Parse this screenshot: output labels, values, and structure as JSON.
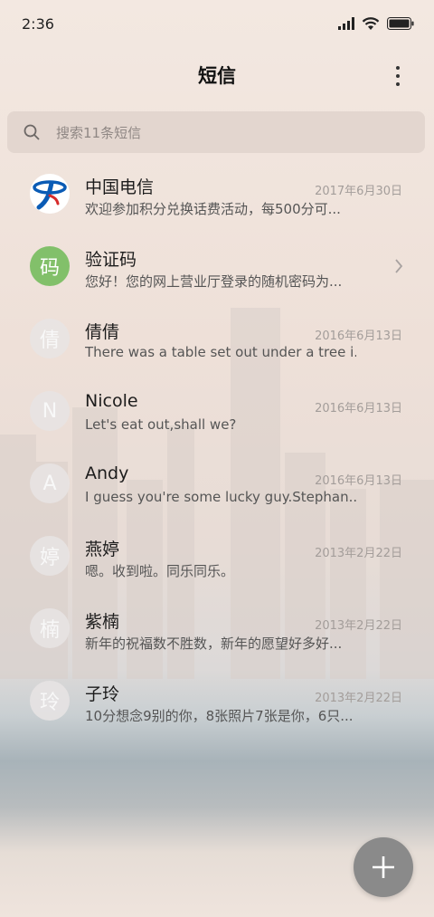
{
  "status_bar": {
    "time": "2:36"
  },
  "header": {
    "title": "短信"
  },
  "search": {
    "placeholder": "搜索11条短信"
  },
  "conversations": [
    {
      "name": "中国电信",
      "date": "2017年6月30日",
      "snippet": "欢迎参加积分兑换话费活动，每500分可...",
      "avatar_type": "logo",
      "avatar_char": ""
    },
    {
      "name": "验证码",
      "date": "",
      "snippet": "您好！您的网上营业厅登录的随机密码为...",
      "avatar_type": "green",
      "avatar_char": "码"
    },
    {
      "name": "倩倩",
      "date": "2016年6月13日",
      "snippet": "There was a table set out under a tree i...",
      "avatar_type": "grey",
      "avatar_char": "倩"
    },
    {
      "name": "Nicole",
      "date": "2016年6月13日",
      "snippet": "Let's eat out,shall we?",
      "avatar_type": "grey",
      "avatar_char": "N"
    },
    {
      "name": "Andy",
      "date": "2016年6月13日",
      "snippet": "I guess you're some lucky guy.Stephan...",
      "avatar_type": "grey",
      "avatar_char": "A"
    },
    {
      "name": "燕婷",
      "date": "2013年2月22日",
      "snippet": "嗯。收到啦。同乐同乐。",
      "avatar_type": "grey",
      "avatar_char": "婷"
    },
    {
      "name": "紫楠",
      "date": "2013年2月22日",
      "snippet": "新年的祝福数不胜数，新年的愿望好多好...",
      "avatar_type": "grey",
      "avatar_char": "楠"
    },
    {
      "name": "子玲",
      "date": "2013年2月22日",
      "snippet": "10分想念9别的你，8张照片7张是你，6只...",
      "avatar_type": "grey",
      "avatar_char": "玲"
    }
  ],
  "colors": {
    "accent_green": "#82c06a",
    "fab": "#8a8a8a",
    "brand_blue": "#0a5bb5"
  },
  "icons": [
    "signal-icon",
    "wifi-icon",
    "battery-icon",
    "more-icon",
    "search-icon",
    "chevron-right-icon",
    "plus-icon",
    "china-telecom-logo"
  ]
}
